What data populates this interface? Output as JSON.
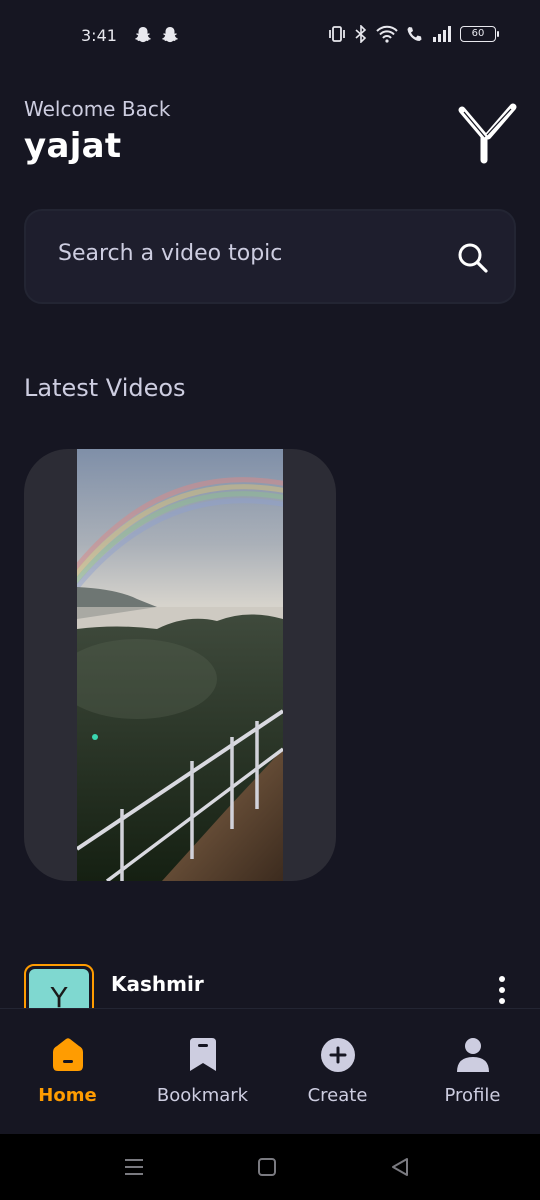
{
  "status_bar": {
    "time": "3:41",
    "battery": "60",
    "icons": [
      "snapchat-icon",
      "snapchat-icon",
      "vibrate-icon",
      "bluetooth-icon",
      "wifi-icon",
      "call-icon",
      "signal-icon",
      "battery-icon"
    ]
  },
  "header": {
    "welcome": "Welcome Back",
    "username": "yajat",
    "logo_letter": "Y"
  },
  "search": {
    "placeholder": "Search a video topic",
    "icon": "search-icon"
  },
  "latest": {
    "title": "Latest Videos"
  },
  "videos": [
    {
      "title": "Kashmir",
      "avatar_letter": "Y"
    }
  ],
  "bottom_nav": [
    {
      "label": "Home",
      "icon": "home-icon",
      "active": true
    },
    {
      "label": "Bookmark",
      "icon": "bookmark-icon",
      "active": false
    },
    {
      "label": "Create",
      "icon": "plus-circle-icon",
      "active": false
    },
    {
      "label": "Profile",
      "icon": "profile-icon",
      "active": false
    }
  ],
  "colors": {
    "background": "#161622",
    "card": "#1e1e2d",
    "accent": "#ff9c01",
    "muted_text": "#cdcde0"
  }
}
